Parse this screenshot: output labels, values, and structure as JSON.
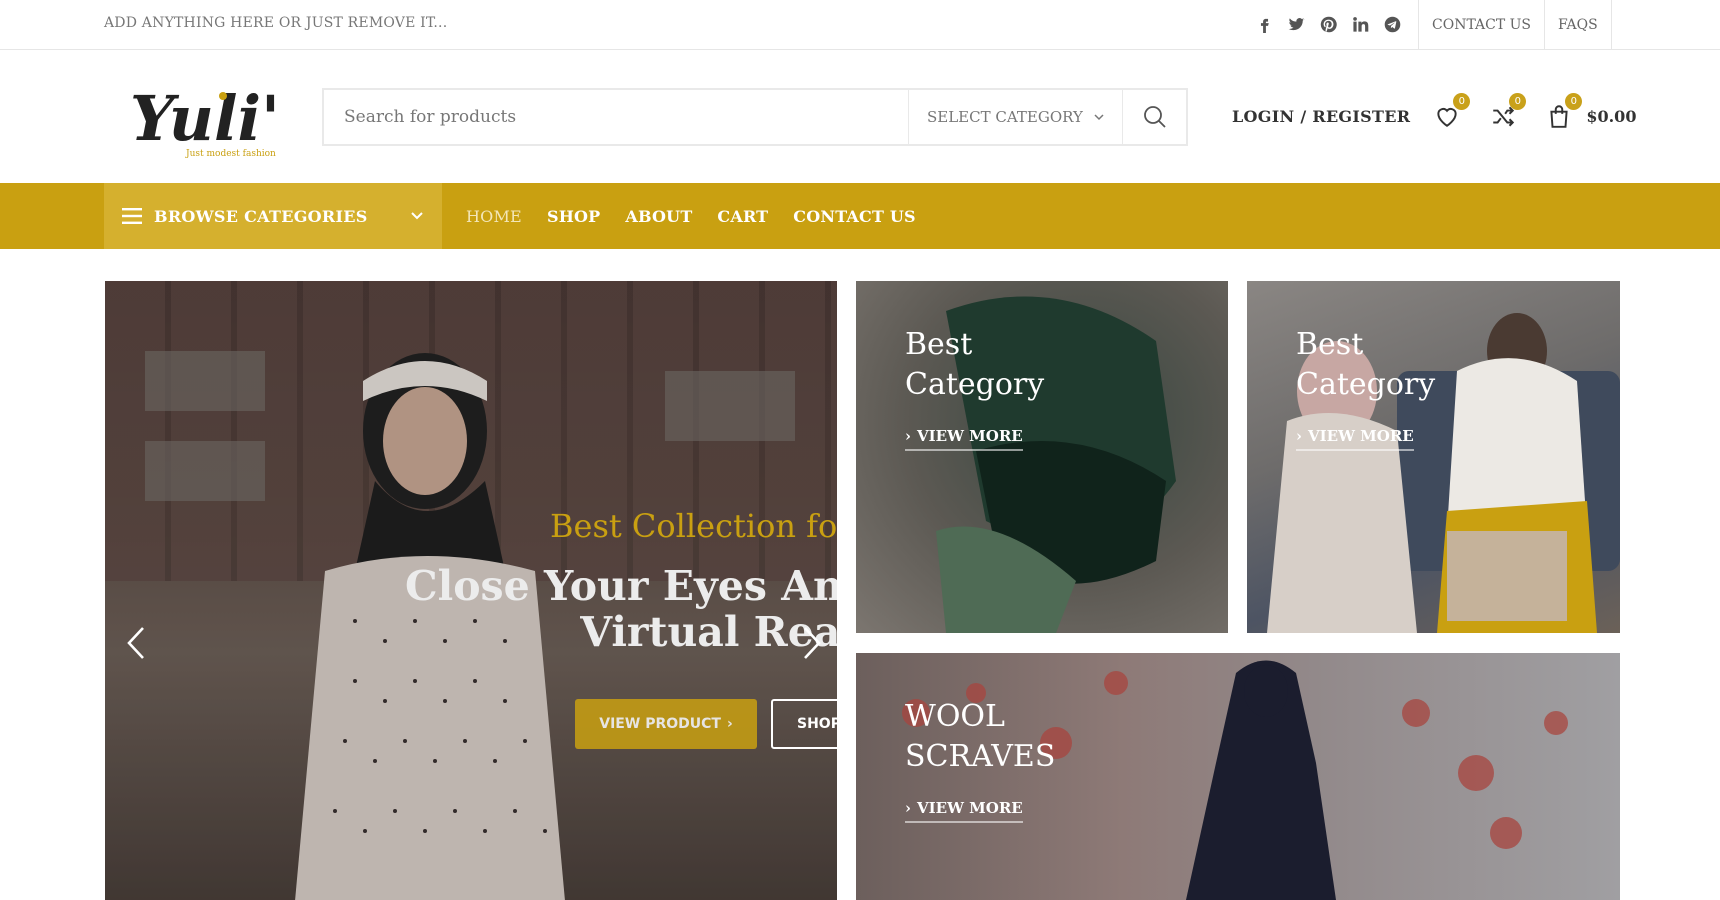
{
  "topbar": {
    "text": "ADD ANYTHING HERE OR JUST REMOVE IT...",
    "socials": [
      "facebook-icon",
      "twitter-icon",
      "pinterest-icon",
      "linkedin-icon",
      "telegram-icon"
    ],
    "links": [
      "CONTACT US",
      "FAQS"
    ]
  },
  "header": {
    "logo_text": "Yuli's",
    "logo_tagline": "Just modest fashion",
    "search_placeholder": "Search for products",
    "category_select": "SELECT CATEGORY",
    "login": "LOGIN / REGISTER",
    "wishlist_count": "0",
    "compare_count": "0",
    "cart_count": "0",
    "cart_total": "$0.00"
  },
  "nav": {
    "browse_label": "BROWSE CATEGORIES",
    "items": [
      "HOME",
      "SHOP",
      "ABOUT",
      "CART",
      "CONTACT US"
    ],
    "active": "HOME"
  },
  "slider": {
    "subtitle": "Best Collection for w",
    "title_line1": "Close Your Eyes And",
    "title_line2": "Virtual Reali",
    "btn_view": "VIEW PRODUCT",
    "btn_shop": "SHOP"
  },
  "banners": [
    {
      "line1": "Best",
      "line2": "Category",
      "link": "VIEW MORE"
    },
    {
      "line1": "Best",
      "line2": "Category",
      "link": "VIEW MORE"
    },
    {
      "line1": "WOOL",
      "line2": "SCRAVES",
      "link": "VIEW MORE"
    }
  ],
  "colors": {
    "accent": "#c9a011",
    "accent_light": "#d5b02e",
    "badge": "#c9a11a"
  }
}
